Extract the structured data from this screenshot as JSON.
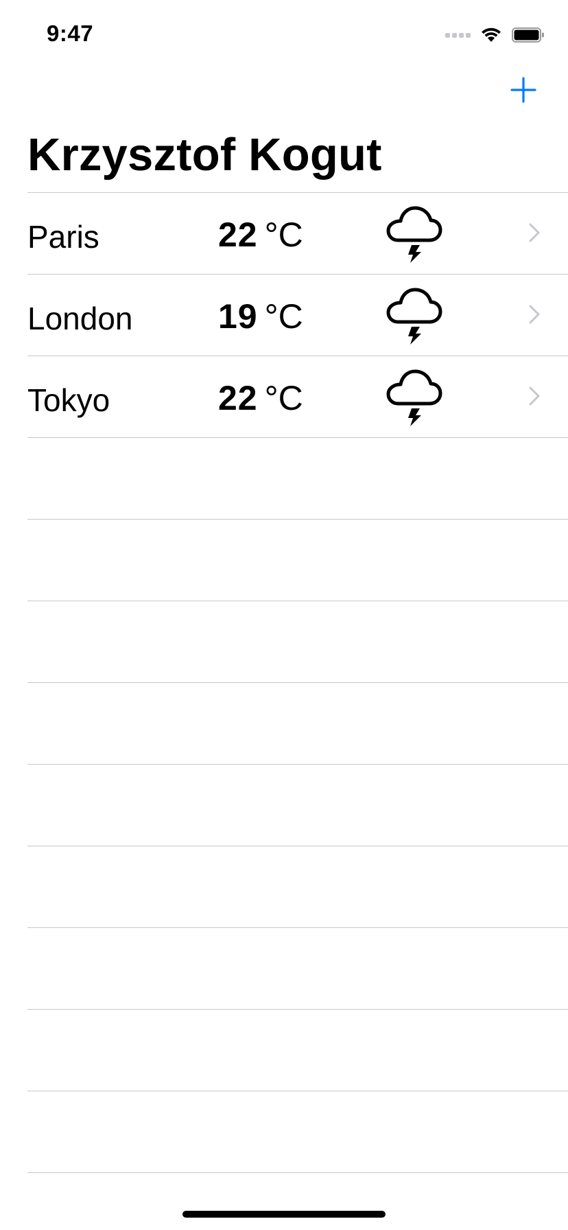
{
  "status_bar": {
    "time": "9:47",
    "icons": [
      "cellular-signal-icon",
      "wifi-icon",
      "battery-icon"
    ]
  },
  "navigation": {
    "add_icon": "plus-icon",
    "title": "Krzysztof Kogut"
  },
  "colors": {
    "accent": "#007AFF",
    "separator": "#C8C7CC",
    "chevron": "#C7C7CC",
    "text": "#000000"
  },
  "cities": [
    {
      "name": "Paris",
      "temperature": "22",
      "unit": "°C",
      "condition_icon": "thunderstorm-icon"
    },
    {
      "name": "London",
      "temperature": "19",
      "unit": "°C",
      "condition_icon": "thunderstorm-icon"
    },
    {
      "name": "Tokyo",
      "temperature": "22",
      "unit": "°C",
      "condition_icon": "thunderstorm-icon"
    }
  ]
}
